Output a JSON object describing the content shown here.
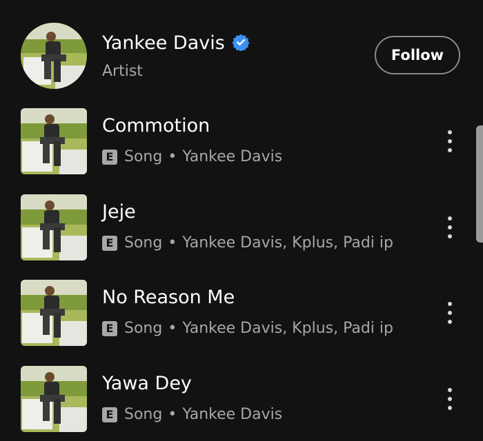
{
  "artist": {
    "name": "Yankee Davis",
    "type": "Artist",
    "verified": true,
    "follow_label": "Follow"
  },
  "songs": [
    {
      "title": "Commotion",
      "badge": "E",
      "kind": "Song",
      "separator": "•",
      "artists": "Yankee Davis"
    },
    {
      "title": "Jeje",
      "badge": "E",
      "kind": "Song",
      "separator": "•",
      "artists": "Yankee Davis, Kplus, Padi ip"
    },
    {
      "title": "No Reason Me",
      "badge": "E",
      "kind": "Song",
      "separator": "•",
      "artists": "Yankee Davis, Kplus, Padi ip"
    },
    {
      "title": "Yawa Dey",
      "badge": "E",
      "kind": "Song",
      "separator": "•",
      "artists": "Yankee Davis"
    }
  ],
  "icons": {
    "verified": "verified-badge-icon",
    "more": "more-options-icon"
  },
  "colors": {
    "background": "#121212",
    "primary_text": "#ffffff",
    "secondary_text": "#a7a7a7",
    "verified_blue": "#3d91f4"
  }
}
